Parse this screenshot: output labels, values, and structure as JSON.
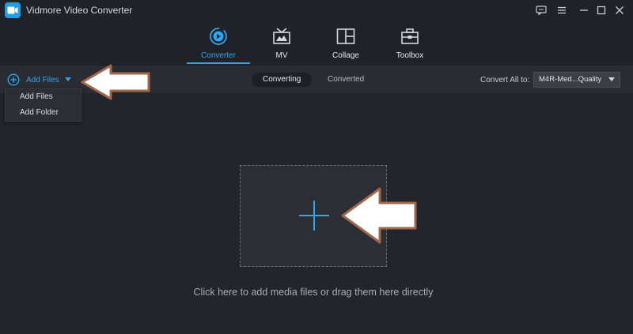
{
  "app": {
    "title": "Vidmore Video Converter"
  },
  "nav": {
    "tabs": [
      {
        "label": "Converter",
        "icon": "converter-icon",
        "active": true
      },
      {
        "label": "MV",
        "icon": "mv-icon",
        "active": false
      },
      {
        "label": "Collage",
        "icon": "collage-icon",
        "active": false
      },
      {
        "label": "Toolbox",
        "icon": "toolbox-icon",
        "active": false
      }
    ]
  },
  "toolbar": {
    "add_files_label": "Add Files",
    "segments": [
      "Converting",
      "Converted"
    ],
    "convert_all_label": "Convert All to:",
    "format_value": "M4R-Med...Quality"
  },
  "dropdown": {
    "items": [
      "Add Files",
      "Add Folder"
    ]
  },
  "dropzone": {
    "hint": "Click here to add media files or drag them here directly"
  },
  "colors": {
    "accent": "#2aa7f0",
    "background": "#23252c",
    "header": "#202228",
    "arrow_fill": "#ffffff",
    "arrow_outline": "#a0674a"
  }
}
